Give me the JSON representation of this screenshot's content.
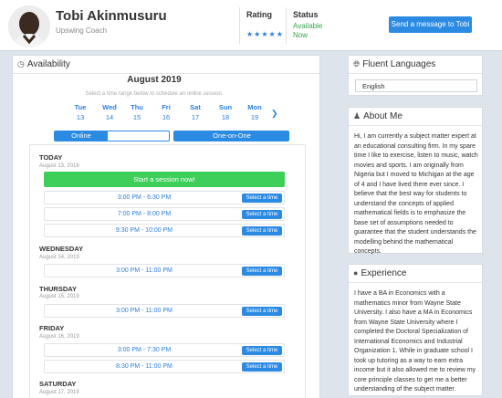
{
  "header": {
    "name": "Tobi Akinmusuru",
    "role": "Upswing Coach",
    "rating_label": "Rating",
    "stars": "★★★★★",
    "status_label": "Status",
    "status_value": "Available Now",
    "message_button": "Send a message to Tobi"
  },
  "availability": {
    "title": "Availability",
    "month": "August 2019",
    "subtitle": "Select a time range below to schedule an online session.",
    "days": [
      {
        "name": "Tue",
        "date": "13"
      },
      {
        "name": "Wed",
        "date": "14"
      },
      {
        "name": "Thu",
        "date": "15"
      },
      {
        "name": "Fri",
        "date": "16"
      },
      {
        "name": "Sat",
        "date": "17"
      },
      {
        "name": "Sun",
        "date": "18"
      },
      {
        "name": "Mon",
        "date": "19"
      }
    ],
    "toggle_online": "Online",
    "toggle_one_on_one": "One-on-One",
    "today_label": "TODAY",
    "today_date": "August 13, 2019",
    "start_session": "Start a session now!",
    "select_label": "Select a time",
    "groups": [
      {
        "day": "TODAY",
        "date": "August 13, 2019",
        "slots": [
          "3:00 PM - 6:30 PM",
          "7:00 PM - 8:00 PM",
          "9:30 PM - 10:00 PM"
        ]
      },
      {
        "day": "WEDNESDAY",
        "date": "August 14, 2019",
        "slots": [
          "3:00 PM - 11:00 PM"
        ]
      },
      {
        "day": "THURSDAY",
        "date": "August 15, 2019",
        "slots": [
          "3:00 PM - 11:00 PM"
        ]
      },
      {
        "day": "FRIDAY",
        "date": "August 16, 2019",
        "slots": [
          "3:00 PM - 7:30 PM",
          "8:30 PM - 11:00 PM"
        ]
      },
      {
        "day": "SATURDAY",
        "date": "August 17, 2019",
        "slots": []
      }
    ]
  },
  "languages": {
    "title": "Fluent Languages",
    "value": "English"
  },
  "about": {
    "title": "About Me",
    "text": "Hi, I am currently a subject matter expert at an educational consulting firm.  In my spare time I like to exercise, listen to music, watch movies and sports.  I am originally from Nigeria but I moved to Michigan at the age of 4 and I have lived there ever since.  I believe that the best way for students to understand the concepts of applied mathematical fields is to emphasize the base set of assumptions needed to guarantee that the student understands the modelling behind the mathematical concepts."
  },
  "experience": {
    "title": "Experience",
    "text": "I have a BA in Economics with a mathematics minor from Wayne State University.  I also have a MA in Economics from Wayne State University where I completed the Doctoral Specialization of International Economics and Industrial Organization 1.  While in graduate school I took up tutoring as a way to earn extra income but it also allowed me to review my core principle classes to get me a better understanding of the subject matter."
  }
}
